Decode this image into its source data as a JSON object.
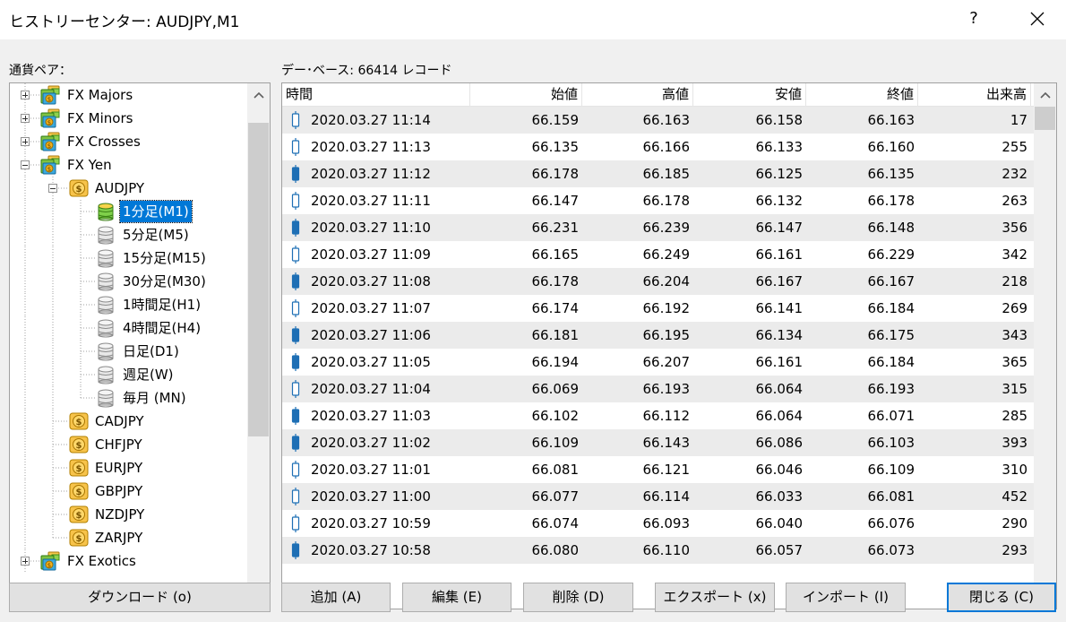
{
  "window": {
    "title": "ヒストリーセンター: AUDJPY,M1",
    "help_glyph": "?"
  },
  "labels": {
    "currency_pairs": "通貨ペア：",
    "database": "デー･ベース: 66414 レコード"
  },
  "tree": {
    "items": [
      {
        "label": "FX Majors",
        "level": 0,
        "expander": "plus",
        "icon": "folder-icon"
      },
      {
        "label": "FX Minors",
        "level": 0,
        "expander": "plus",
        "icon": "folder-icon"
      },
      {
        "label": "FX Crosses",
        "level": 0,
        "expander": "plus",
        "icon": "folder-icon"
      },
      {
        "label": "FX Yen",
        "level": 0,
        "expander": "minus",
        "icon": "folder-icon"
      },
      {
        "label": "AUDJPY",
        "level": 1,
        "expander": "minus",
        "icon": "dollar-coin-icon"
      },
      {
        "label": "1分足(M1)",
        "level": 2,
        "icon": "database-active-icon",
        "selected": true
      },
      {
        "label": "5分足(M5)",
        "level": 2,
        "icon": "database-icon"
      },
      {
        "label": "15分足(M15)",
        "level": 2,
        "icon": "database-icon"
      },
      {
        "label": "30分足(M30)",
        "level": 2,
        "icon": "database-icon"
      },
      {
        "label": "1時間足(H1)",
        "level": 2,
        "icon": "database-icon"
      },
      {
        "label": "4時間足(H4)",
        "level": 2,
        "icon": "database-icon"
      },
      {
        "label": "日足(D1)",
        "level": 2,
        "icon": "database-icon"
      },
      {
        "label": "週足(W)",
        "level": 2,
        "icon": "database-icon"
      },
      {
        "label": "毎月 (MN)",
        "level": 2,
        "icon": "database-icon"
      },
      {
        "label": "CADJPY",
        "level": 1,
        "icon": "dollar-coin-icon"
      },
      {
        "label": "CHFJPY",
        "level": 1,
        "icon": "dollar-coin-icon"
      },
      {
        "label": "EURJPY",
        "level": 1,
        "icon": "dollar-coin-icon"
      },
      {
        "label": "GBPJPY",
        "level": 1,
        "icon": "dollar-coin-icon"
      },
      {
        "label": "NZDJPY",
        "level": 1,
        "icon": "dollar-coin-icon"
      },
      {
        "label": "ZARJPY",
        "level": 1,
        "icon": "dollar-coin-icon"
      },
      {
        "label": "FX Exotics",
        "level": 0,
        "expander": "plus",
        "icon": "folder-icon"
      }
    ]
  },
  "table": {
    "columns": [
      "時間",
      "始値",
      "高値",
      "安値",
      "終値",
      "出来高"
    ],
    "rows": [
      {
        "time": "2020.03.27 11:14",
        "open": "66.159",
        "high": "66.163",
        "low": "66.158",
        "close": "66.163",
        "volume": "17",
        "candle": "bull"
      },
      {
        "time": "2020.03.27 11:13",
        "open": "66.135",
        "high": "66.166",
        "low": "66.133",
        "close": "66.160",
        "volume": "255",
        "candle": "bull"
      },
      {
        "time": "2020.03.27 11:12",
        "open": "66.178",
        "high": "66.185",
        "low": "66.125",
        "close": "66.135",
        "volume": "232",
        "candle": "bear"
      },
      {
        "time": "2020.03.27 11:11",
        "open": "66.147",
        "high": "66.178",
        "low": "66.132",
        "close": "66.178",
        "volume": "263",
        "candle": "bull"
      },
      {
        "time": "2020.03.27 11:10",
        "open": "66.231",
        "high": "66.239",
        "low": "66.147",
        "close": "66.148",
        "volume": "356",
        "candle": "bear"
      },
      {
        "time": "2020.03.27 11:09",
        "open": "66.165",
        "high": "66.249",
        "low": "66.161",
        "close": "66.229",
        "volume": "342",
        "candle": "bull"
      },
      {
        "time": "2020.03.27 11:08",
        "open": "66.178",
        "high": "66.204",
        "low": "66.167",
        "close": "66.167",
        "volume": "218",
        "candle": "bear"
      },
      {
        "time": "2020.03.27 11:07",
        "open": "66.174",
        "high": "66.192",
        "low": "66.141",
        "close": "66.184",
        "volume": "269",
        "candle": "bull"
      },
      {
        "time": "2020.03.27 11:06",
        "open": "66.181",
        "high": "66.195",
        "low": "66.134",
        "close": "66.175",
        "volume": "343",
        "candle": "bear"
      },
      {
        "time": "2020.03.27 11:05",
        "open": "66.194",
        "high": "66.207",
        "low": "66.161",
        "close": "66.184",
        "volume": "365",
        "candle": "bear"
      },
      {
        "time": "2020.03.27 11:04",
        "open": "66.069",
        "high": "66.193",
        "low": "66.064",
        "close": "66.193",
        "volume": "315",
        "candle": "bull"
      },
      {
        "time": "2020.03.27 11:03",
        "open": "66.102",
        "high": "66.112",
        "low": "66.064",
        "close": "66.071",
        "volume": "285",
        "candle": "bear"
      },
      {
        "time": "2020.03.27 11:02",
        "open": "66.109",
        "high": "66.143",
        "low": "66.086",
        "close": "66.103",
        "volume": "393",
        "candle": "bear"
      },
      {
        "time": "2020.03.27 11:01",
        "open": "66.081",
        "high": "66.121",
        "low": "66.046",
        "close": "66.109",
        "volume": "310",
        "candle": "bull"
      },
      {
        "time": "2020.03.27 11:00",
        "open": "66.077",
        "high": "66.114",
        "low": "66.033",
        "close": "66.081",
        "volume": "452",
        "candle": "bull"
      },
      {
        "time": "2020.03.27 10:59",
        "open": "66.074",
        "high": "66.093",
        "low": "66.040",
        "close": "66.076",
        "volume": "290",
        "candle": "bull"
      },
      {
        "time": "2020.03.27 10:58",
        "open": "66.080",
        "high": "66.110",
        "low": "66.057",
        "close": "66.073",
        "volume": "293",
        "candle": "bear"
      }
    ]
  },
  "buttons": {
    "download": "ダウンロード (o)",
    "add": "追加 (A)",
    "edit": "編集 (E)",
    "delete": "削除 (D)",
    "export": "エクスポート (x)",
    "import": "インポート (I)",
    "close": "閉じる (C)"
  },
  "colors": {
    "selection": "#0078d7",
    "row_alt": "#ebebeb",
    "candle_blue": "#1e6fb5",
    "coin_gold": "#f2b11c"
  }
}
